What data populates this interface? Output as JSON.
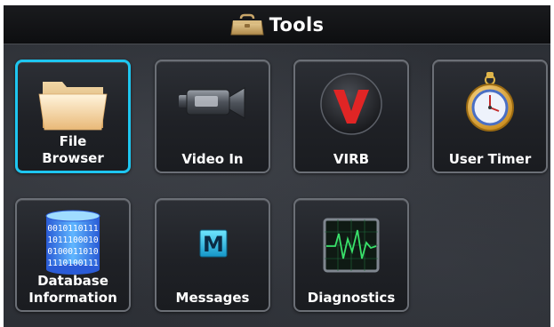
{
  "header": {
    "title": "Tools",
    "icon": "toolbox-icon"
  },
  "tiles": [
    {
      "label_line1": "File",
      "label_line2": "Browser",
      "icon": "folder-icon",
      "selected": true
    },
    {
      "label_line1": "",
      "label_line2": "Video In",
      "icon": "video-camera-icon",
      "selected": false
    },
    {
      "label_line1": "",
      "label_line2": "VIRB",
      "icon": "virb-logo-icon",
      "selected": false
    },
    {
      "label_line1": "",
      "label_line2": "User Timer",
      "icon": "stopwatch-icon",
      "selected": false
    },
    {
      "label_line1": "Database",
      "label_line2": "Information",
      "icon": "database-icon",
      "selected": false
    },
    {
      "label_line1": "",
      "label_line2": "Messages",
      "icon": "messages-icon",
      "selected": false
    },
    {
      "label_line1": "",
      "label_line2": "Diagnostics",
      "icon": "diagnostics-icon",
      "selected": false
    }
  ],
  "colors": {
    "selection_border": "#1ec6f0",
    "tile_border": "#6b6f76",
    "background": "#2e3137"
  },
  "icon_text": {
    "messages_letter": "M",
    "database_bits": [
      "0010110111",
      "1011100010",
      "0100011010",
      "1110100111"
    ]
  }
}
